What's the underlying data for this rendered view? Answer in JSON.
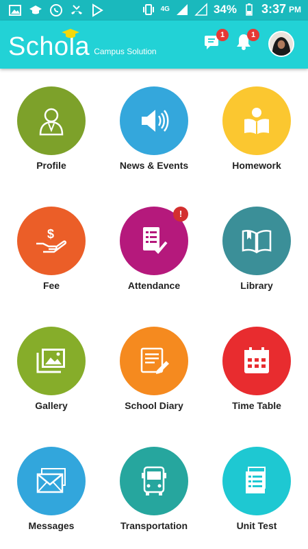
{
  "status_bar": {
    "network": "4G",
    "battery": "34%",
    "time": "3:37",
    "ampm": "PM"
  },
  "app_bar": {
    "logo_text": "Schola",
    "logo_subtitle": "Campus Solution",
    "messages_badge": "1",
    "notifications_badge": "1"
  },
  "colors": {
    "status_bar": "#1ab9bd",
    "app_bar": "#22d2d6"
  },
  "tiles": [
    {
      "label": "Profile",
      "color": "#7da12a",
      "icon": "user-icon"
    },
    {
      "label": "News & Events",
      "color": "#34a7dc",
      "icon": "speaker-icon"
    },
    {
      "label": "Homework",
      "color": "#fbc730",
      "icon": "reading-icon"
    },
    {
      "label": "Fee",
      "color": "#eb5e28",
      "icon": "money-hand-icon"
    },
    {
      "label": "Attendance",
      "color": "#b5197c",
      "icon": "checklist-icon",
      "badge": "!"
    },
    {
      "label": "Library",
      "color": "#3b8f98",
      "icon": "book-icon"
    },
    {
      "label": "Gallery",
      "color": "#86ad2a",
      "icon": "gallery-icon"
    },
    {
      "label": "School Diary",
      "color": "#f58a1f",
      "icon": "diary-icon"
    },
    {
      "label": "Time Table",
      "color": "#e82c2f",
      "icon": "calendar-icon"
    },
    {
      "label": "Messages",
      "color": "#32a6dc",
      "icon": "envelope-icon"
    },
    {
      "label": "Transportation",
      "color": "#26a69e",
      "icon": "bus-icon"
    },
    {
      "label": "Unit Test",
      "color": "#1ec8d2",
      "icon": "test-sheet-icon"
    }
  ]
}
